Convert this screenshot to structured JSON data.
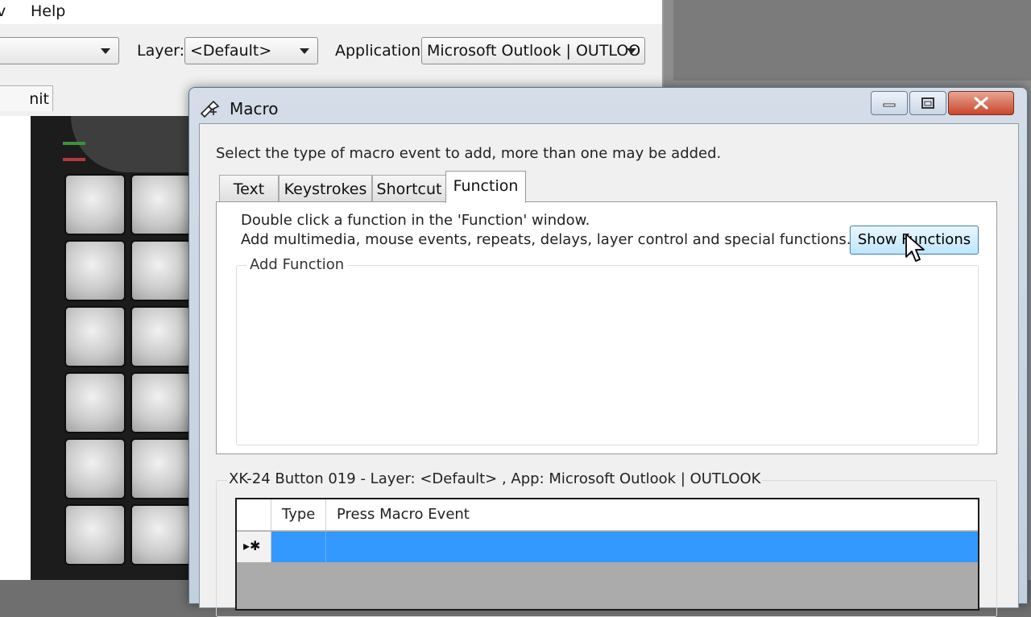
{
  "background_app": {
    "menu": {
      "partial_item": "v",
      "help": "Help"
    },
    "toolbar": {
      "layer_label": "Layer:",
      "layer_value": "<Default>",
      "application_label": "Application:",
      "application_value": "Microsoft Outlook | OUTLOO"
    },
    "tab_unit_data": "nit Data"
  },
  "dialog": {
    "title": "Macro",
    "instruction": "Select the type of macro event to add, more than one may be added.",
    "tabs": [
      {
        "label": "Text"
      },
      {
        "label": "Keystrokes"
      },
      {
        "label": "Shortcut"
      },
      {
        "label": "Function",
        "active": true
      }
    ],
    "function_tab": {
      "line1": "Double click a function in the 'Function' window.",
      "line2": "Add multimedia, mouse events, repeats, delays, layer control and special functions.",
      "show_functions_button": "Show Functions",
      "add_function_group": "Add Function"
    },
    "events_caption": "XK-24 Button 019 - Layer: <Default> , App: Microsoft Outlook | OUTLOOK",
    "grid": {
      "columns": [
        "Type",
        "Press Macro Event"
      ],
      "new_row_marker": "▸✱"
    }
  },
  "colors": {
    "selection": "#3399ff",
    "button_hover": "#bee6fd",
    "close_button": "#c9462c",
    "led_green": "#3f8f3f",
    "led_red": "#b23a3a"
  }
}
